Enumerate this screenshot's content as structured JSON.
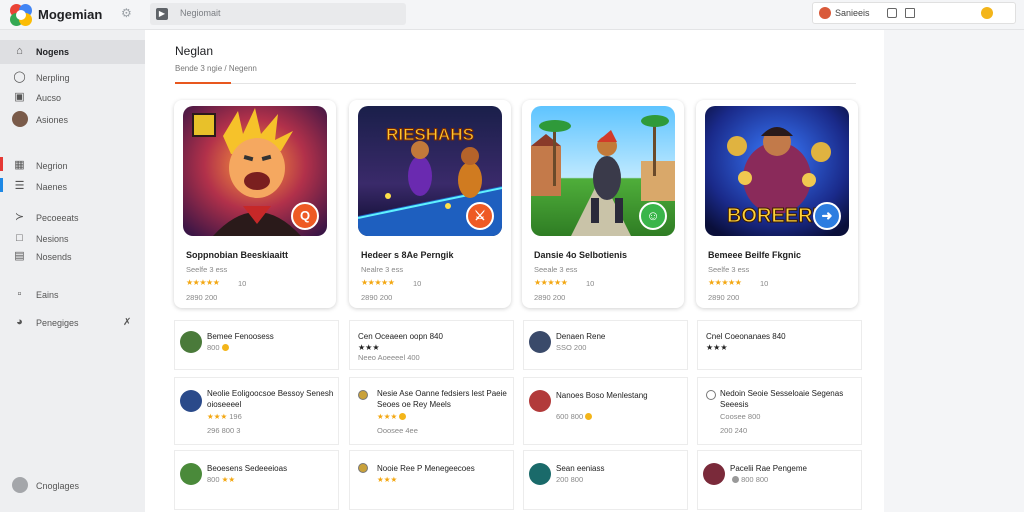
{
  "app": {
    "title": "Mogemian"
  },
  "search": {
    "label": "Negiomait",
    "placeholder": ""
  },
  "account": {
    "label": "Sanieeis"
  },
  "colors": {
    "accent": "#e8571e",
    "star": "#f3a712",
    "coin": "#f3b51a",
    "sidebar_active": "#dedfe2",
    "sidebar_marker_red": "#e53935",
    "sidebar_marker_blue": "#1e88e5",
    "badge_orange": "#ee5a24",
    "badge_green": "#3ab54a",
    "badge_blue": "#2d7de0"
  },
  "sidebar": {
    "items": [
      {
        "label": "Nogens",
        "icon": "home-icon"
      },
      {
        "label": "Nerpling",
        "icon": "bell-icon"
      },
      {
        "label": "Aucso",
        "icon": "library-icon"
      },
      {
        "label": "Asiones",
        "icon": "avatar-icon"
      },
      {
        "label": "Negrion",
        "icon": "grid-icon"
      },
      {
        "label": "Naenes",
        "icon": "list-icon"
      },
      {
        "label": "Pecoeeats",
        "icon": "share-icon"
      },
      {
        "label": "Nesions",
        "icon": "folder-icon"
      },
      {
        "label": "Nosends",
        "icon": "calendar-icon"
      },
      {
        "label": "Eains",
        "icon": "document-icon"
      },
      {
        "label": "Penegiges",
        "icon": "clock-icon"
      },
      {
        "label": "Cnoglages",
        "icon": "user-icon"
      }
    ]
  },
  "main": {
    "title": "Neglan",
    "breadcrumb": "Bende 3 ngie / Negenn"
  },
  "games": [
    {
      "title": "Soppnobian Beeskiaaitt",
      "sub": "Seelfe 3 ess",
      "rating": "10",
      "stats": "2890 200",
      "badge": "Q",
      "badge_color": "#ee5a24",
      "art": "hero-art"
    },
    {
      "title": "Hedeer s 8Ae Perngik",
      "sub": "Nealre 3 ess",
      "rating": "10",
      "stats": "2890 200",
      "badge": "⚔",
      "badge_color": "#ee5a24",
      "art": "arena-art",
      "art_text": "RIESHAHS"
    },
    {
      "title": "Dansie 4o Selbotienis",
      "sub": "Seeale 3 ess",
      "rating": "10",
      "stats": "2890 200",
      "badge": "☺",
      "badge_color": "#3ab54a",
      "art": "jungle-art"
    },
    {
      "title": "Bemeee Beilfe Fkgnic",
      "sub": "Seelfe 3 ess",
      "rating": "10",
      "stats": "2890 200",
      "badge": "➜",
      "badge_color": "#2d7de0",
      "art": "boss-art",
      "art_text": "BOREERU"
    }
  ],
  "list": [
    {
      "name": "Bemee Fenoosess",
      "meta": "800",
      "stars": "",
      "avatar": "#4a7a3a"
    },
    {
      "name": "Cen Oceaeen oopn 840 ★★★",
      "meta": "Neeo Aoeeeel 400",
      "stars": "",
      "avatar": ""
    },
    {
      "name": "Denaen Rene",
      "meta": "SSO 200",
      "stars": "",
      "avatar": "#3a4a6a"
    },
    {
      "name": "Cnel Coeonanaes 840 ★★★",
      "meta": "",
      "stars": "",
      "avatar": ""
    },
    {
      "name": "Neolie Eoligoocsoe Bessoy Senesh oioseeeel",
      "meta": "296 800 3",
      "stars": "★★★",
      "rating": "196",
      "avatar": "#2a4a8a"
    },
    {
      "name": "Nesie Ase Oanne fedsiers lest Paeie Seoes oe Rey Meels",
      "meta": "Ooosee 4ee",
      "stars": "★★★",
      "rating": "",
      "avatar": "#c9a13a"
    },
    {
      "name": "Nanoes Boso Menlestang",
      "meta": "",
      "stars": "",
      "rating": "600 800",
      "avatar": "#b23a3a"
    },
    {
      "name": "Nedoin Seoie Sesseloaie Segenas Seeesis",
      "meta": "200 240",
      "stars": "",
      "rating": "Coosee 800",
      "avatar": ""
    },
    {
      "name": "Beoesens Sedeeeioas",
      "meta": "800",
      "stars": "",
      "avatar": "#4a8a3a"
    },
    {
      "name": "Nooie Ree P Menegeecoes",
      "meta": "",
      "stars": "★★★",
      "avatar": "#c9a13a"
    },
    {
      "name": "Sean eeniass",
      "meta": "200 800",
      "stars": "",
      "avatar": "#1a6a6a"
    },
    {
      "name": "Pacelii Rae Pengeme",
      "meta": "800 800",
      "stars": "",
      "avatar": "#7a2a3a"
    }
  ]
}
